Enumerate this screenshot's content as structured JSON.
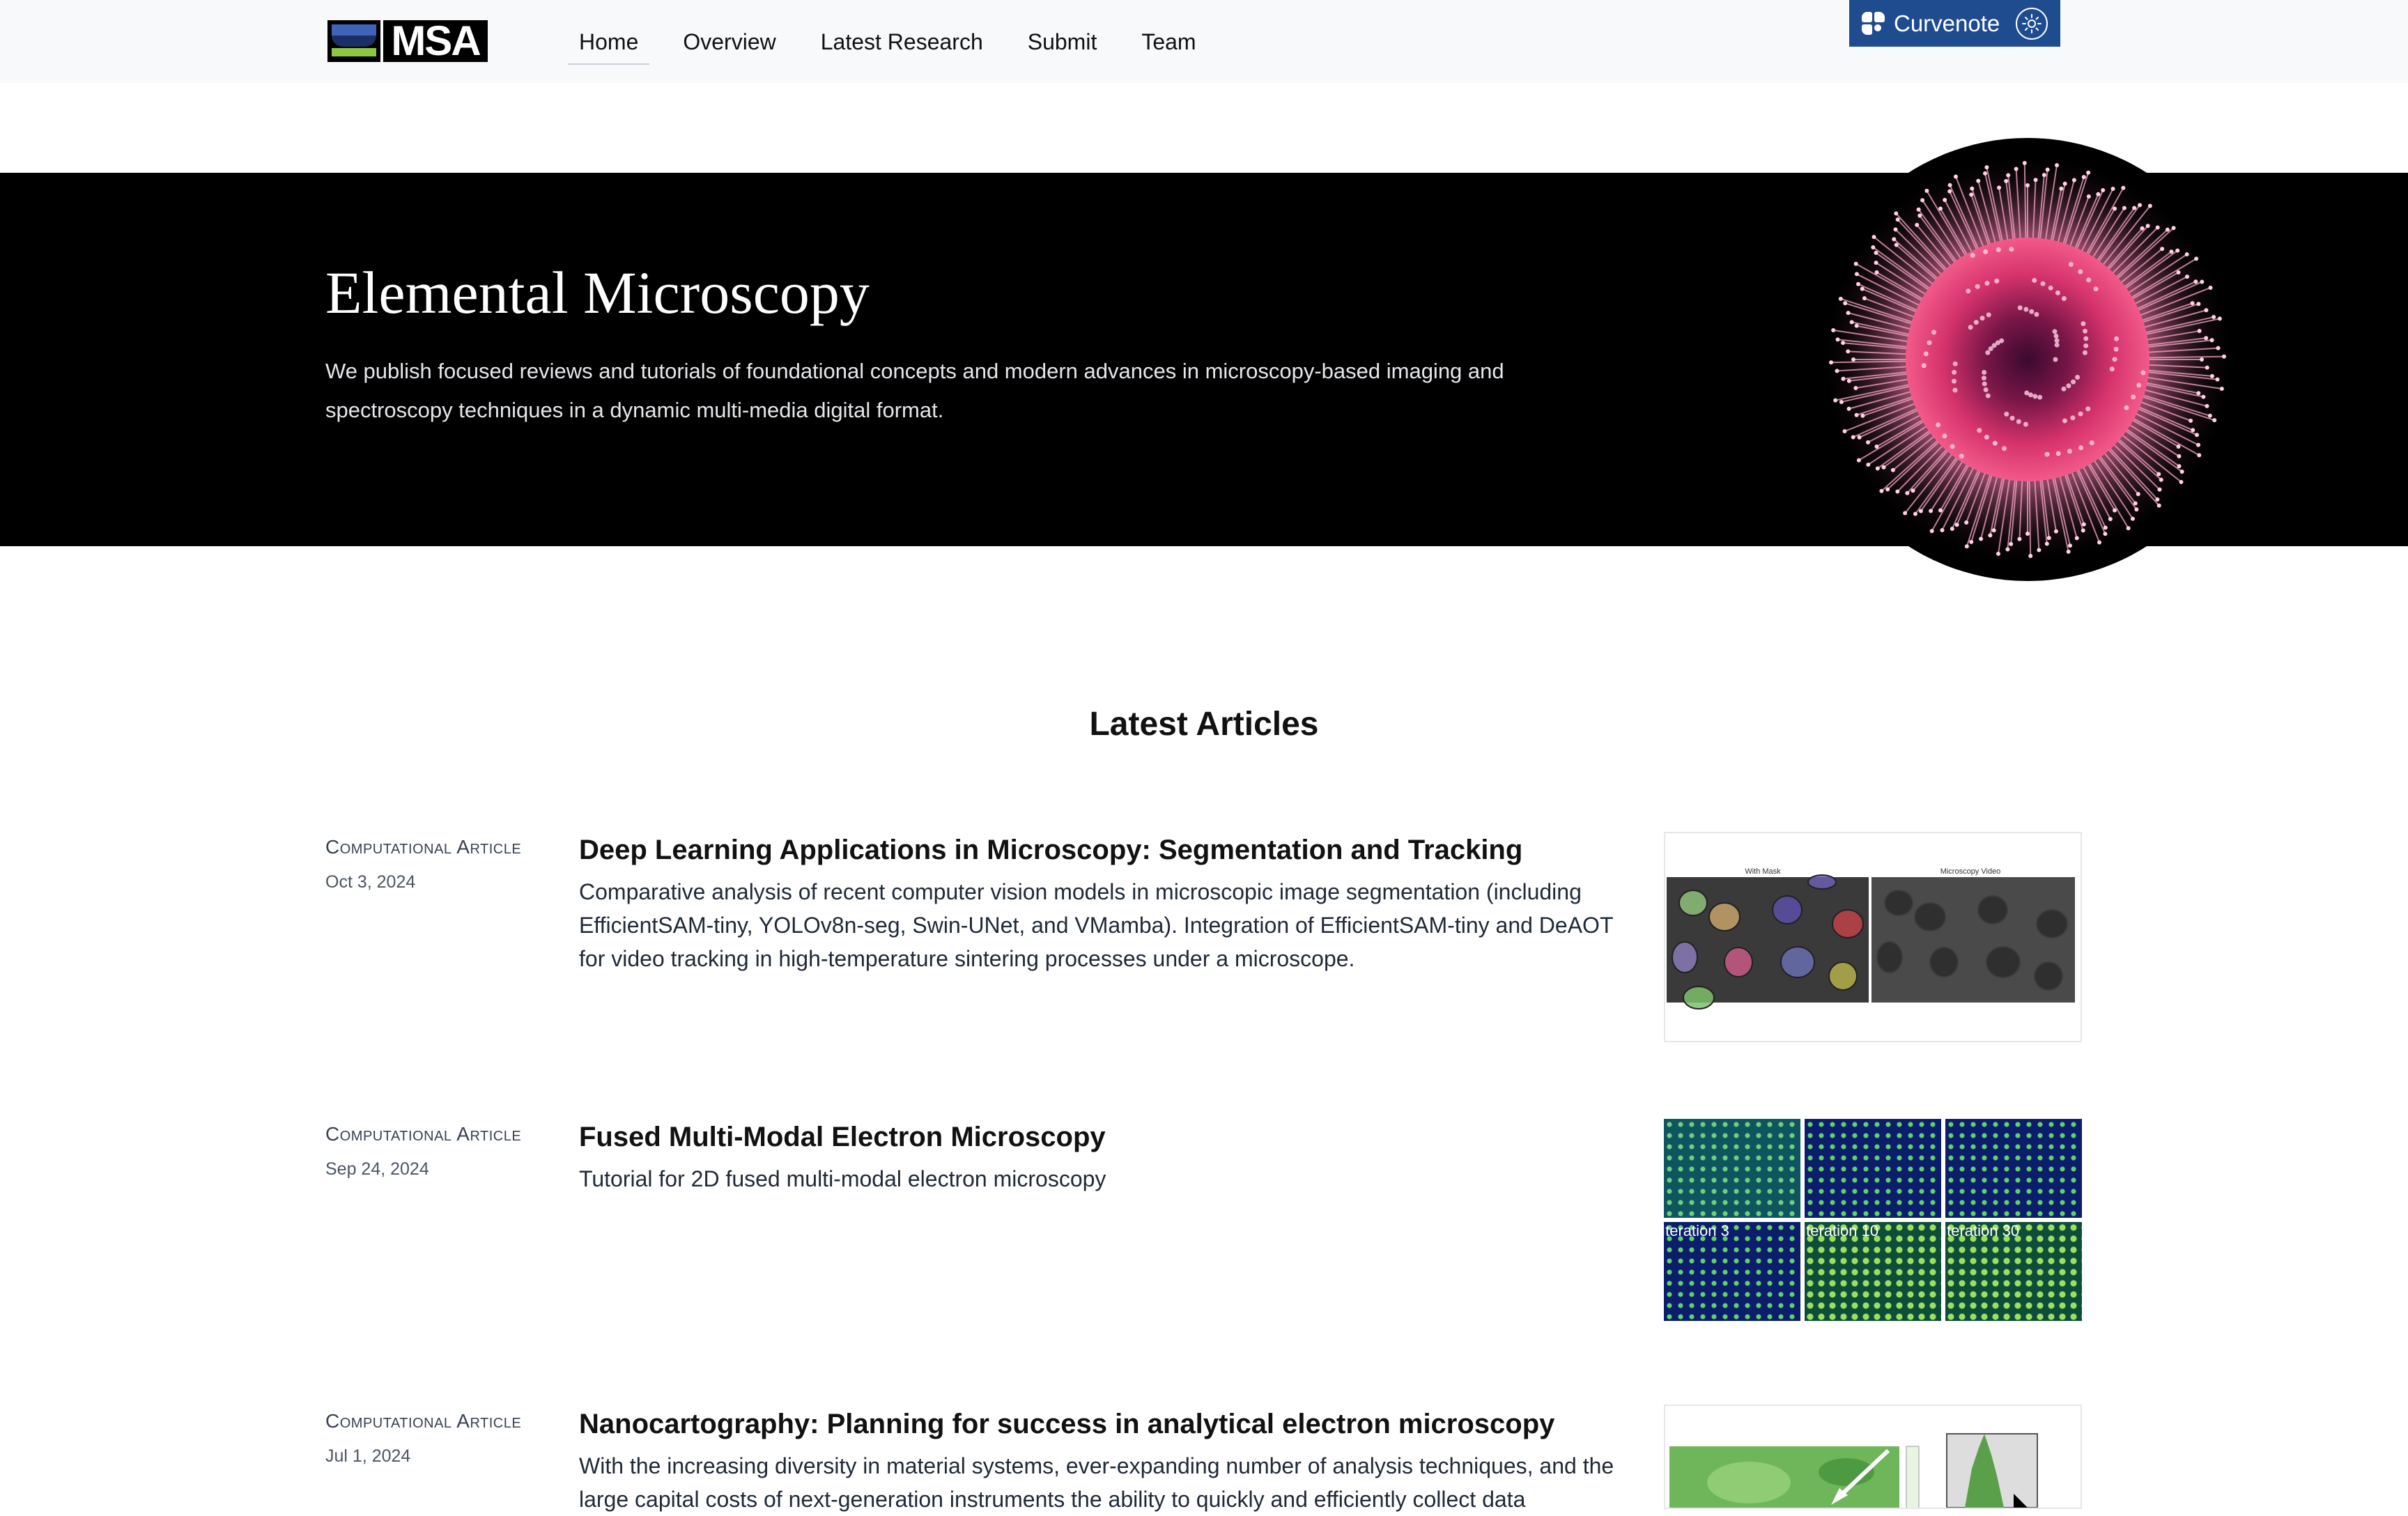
{
  "nav": {
    "logo_text": "MSA",
    "items": [
      "Home",
      "Overview",
      "Latest Research",
      "Submit",
      "Team"
    ],
    "curvenote_label": "Curvenote"
  },
  "hero": {
    "title": "Elemental Microscopy",
    "description": "We publish focused reviews and tutorials of foundational concepts and modern advances in microscopy-based imaging and spectroscopy techniques in a dynamic multi-media digital format."
  },
  "latest": {
    "heading": "Latest Articles",
    "articles": [
      {
        "kind": "Computational Article",
        "date": "Oct 3, 2024",
        "title": "Deep Learning Applications in Microscopy: Segmentation and Tracking",
        "summary": "Comparative analysis of recent computer vision models in microscopic image segmentation (including EfficientSAM-tiny, YOLOv8n-seg, Swin-UNet, and VMamba). Integration of EfficientSAM-tiny and DeAOT for video tracking in high-temperature sintering processes under a microscope.",
        "thumb_labels": [
          "With Mask",
          "Microscopy Video"
        ]
      },
      {
        "kind": "Computational Article",
        "date": "Sep 24, 2024",
        "title": "Fused Multi-Modal Electron Microscopy",
        "summary": "Tutorial for 2D fused multi-modal electron microscopy",
        "thumb_labels": [
          "Iteration 3",
          "Iteration 10",
          "Iteration 30"
        ]
      },
      {
        "kind": "Computational Article",
        "date": "Jul 1, 2024",
        "title": "Nanocartography: Planning for success in analytical electron microscopy",
        "summary": "With the increasing diversity in material systems, ever-expanding number of analysis techniques, and the large capital costs of next-generation instruments the ability to quickly and efficiently collect data"
      }
    ]
  }
}
